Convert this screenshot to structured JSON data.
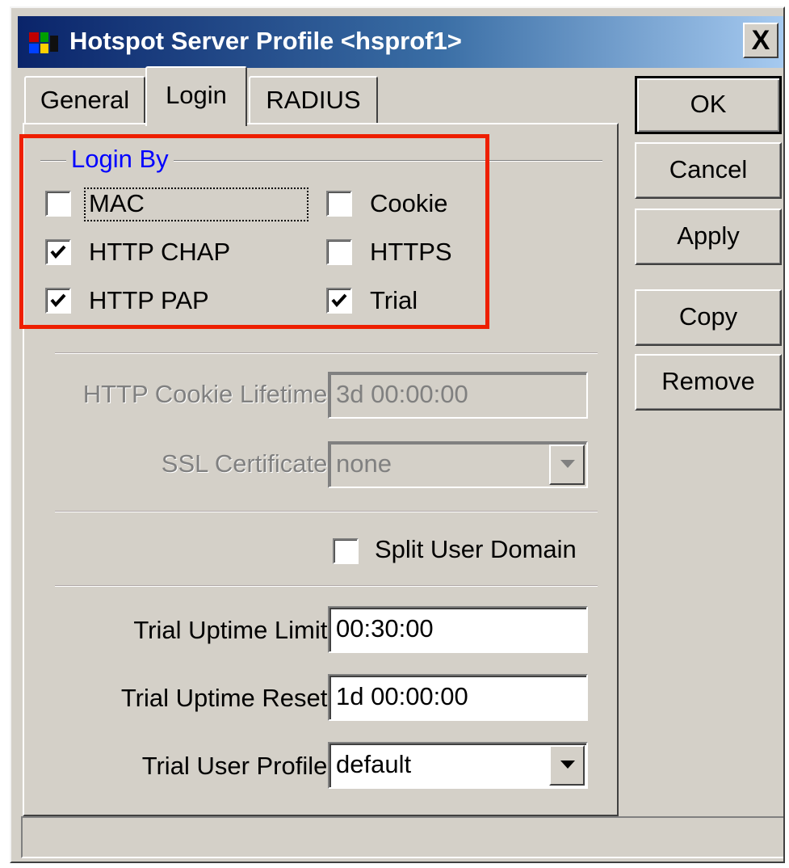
{
  "window": {
    "title": "Hotspot Server Profile <hsprof1>",
    "close_label": "X"
  },
  "tabs": [
    {
      "label": "General",
      "active": false
    },
    {
      "label": "Login",
      "active": true
    },
    {
      "label": "RADIUS",
      "active": false
    }
  ],
  "login_by": {
    "legend": "Login By",
    "options": {
      "mac": {
        "label": "MAC",
        "checked": false
      },
      "cookie": {
        "label": "Cookie",
        "checked": false
      },
      "http_chap": {
        "label": "HTTP CHAP",
        "checked": true
      },
      "https": {
        "label": "HTTPS",
        "checked": false
      },
      "http_pap": {
        "label": "HTTP PAP",
        "checked": true
      },
      "trial": {
        "label": "Trial",
        "checked": true
      }
    }
  },
  "fields": {
    "cookie_lifetime": {
      "label": "HTTP Cookie Lifetime:",
      "value": "3d 00:00:00"
    },
    "ssl_certificate": {
      "label": "SSL Certificate:",
      "value": "none"
    },
    "split_user_domain": {
      "label": "Split User Domain",
      "checked": false
    },
    "trial_uptime_limit": {
      "label": "Trial Uptime Limit:",
      "value": "00:30:00"
    },
    "trial_uptime_reset": {
      "label": "Trial Uptime Reset:",
      "value": "1d 00:00:00"
    },
    "trial_user_profile": {
      "label": "Trial User Profile:",
      "value": "default"
    }
  },
  "buttons": {
    "ok": "OK",
    "cancel": "Cancel",
    "apply": "Apply",
    "copy": "Copy",
    "remove": "Remove"
  },
  "colors": {
    "highlight": "#ee1f00",
    "legend": "#0000ff",
    "titlebar": "#0a246a"
  }
}
